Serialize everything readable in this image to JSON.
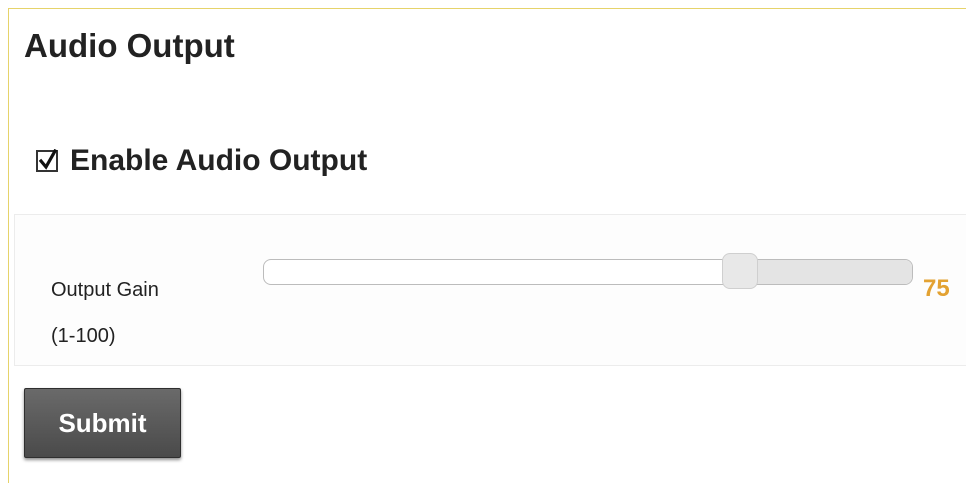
{
  "page": {
    "title": "Audio Output"
  },
  "enable_audio": {
    "label": "Enable Audio Output",
    "checked": true,
    "icon": "check-icon"
  },
  "output_gain": {
    "label_line1": "Output Gain",
    "label_line2": "(1-100)",
    "value": "75",
    "min": 1,
    "max": 100,
    "value_color": "#e3a232"
  },
  "actions": {
    "submit_label": "Submit"
  }
}
